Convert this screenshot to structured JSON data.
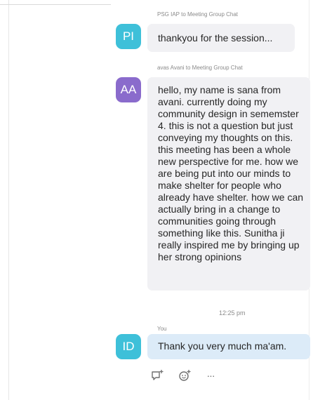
{
  "messages": [
    {
      "initials": "PI",
      "avatar_color": "#3ec0d9",
      "sender_line": "PSG IAP to Meeting Group Chat",
      "text": "thankyou for the session..."
    },
    {
      "initials": "AA",
      "avatar_color": "#8a6bcc",
      "sender_line": "avas Avani to Meeting Group Chat",
      "text": "hello, my name is sana from avani. currently doing my community design in sememster 4. this is not a question but just conveying my thoughts on this. this meeting has been a whole new perspective for me. how we are being put into our minds to make shelter for people who already have shelter. how we can actually bring in a change to communities going through something like this. Sunitha ji really inspired me by bringing up her strong opinions"
    }
  ],
  "timestamp": "12:25 pm",
  "own_message": {
    "initials": "ID",
    "avatar_color": "#3ec0d9",
    "sender_line": "You",
    "text": "Thank you very much ma'am."
  },
  "actions": [
    {
      "icon": "reply-add-icon"
    },
    {
      "icon": "emoji-add-icon"
    },
    {
      "icon": "more-options-icon",
      "label": "···"
    }
  ]
}
